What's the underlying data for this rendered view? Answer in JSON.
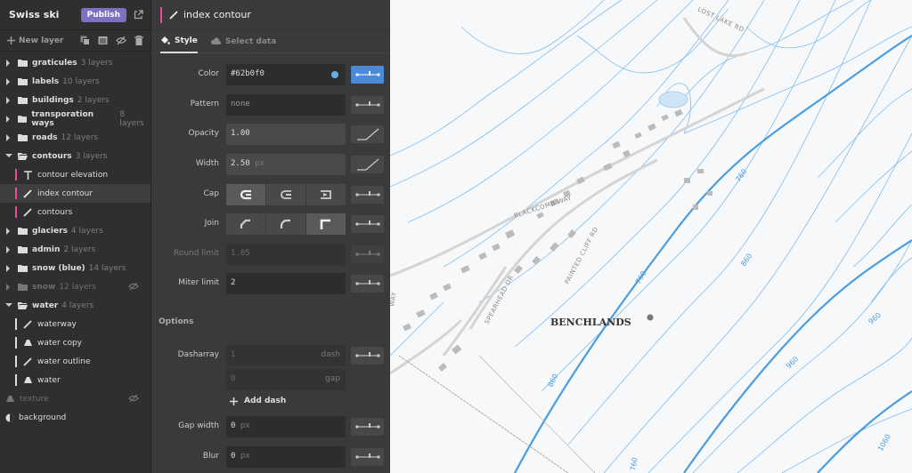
{
  "app": {
    "project_title": "Swiss ski",
    "publish_label": "Publish"
  },
  "toolbar": {
    "new_layer_label": "New layer"
  },
  "layers": {
    "graticules": {
      "name": "graticules",
      "count": "3 layers"
    },
    "labels": {
      "name": "labels",
      "count": "10 layers"
    },
    "buildings": {
      "name": "buildings",
      "count": "2 layers"
    },
    "transport": {
      "name": "transporation ways",
      "count": "8 layers"
    },
    "roads": {
      "name": "roads",
      "count": "12 layers"
    },
    "contours": {
      "name": "contours",
      "count": "3 layers"
    },
    "contour_elevation": {
      "name": "contour elevation"
    },
    "index_contour": {
      "name": "index contour"
    },
    "contours_child": {
      "name": "contours"
    },
    "glaciers": {
      "name": "glaciers",
      "count": "4 layers"
    },
    "admin": {
      "name": "admin",
      "count": "2 layers"
    },
    "snow_blue": {
      "name": "snow (blue)",
      "count": "14 layers"
    },
    "snow": {
      "name": "snow",
      "count": "12 layers"
    },
    "water": {
      "name": "water",
      "count": "4 layers"
    },
    "waterway": {
      "name": "waterway"
    },
    "water_copy": {
      "name": "water copy"
    },
    "water_outline": {
      "name": "water outline"
    },
    "water_child": {
      "name": "water"
    },
    "texture": {
      "name": "texture"
    },
    "background": {
      "name": "background"
    }
  },
  "panel": {
    "title": "index contour",
    "tabs": {
      "style": "Style",
      "select_data": "Select data"
    },
    "labels": {
      "color": "Color",
      "pattern": "Pattern",
      "opacity": "Opacity",
      "width": "Width",
      "cap": "Cap",
      "join": "Join",
      "round_limit": "Round limit",
      "miter_limit": "Miter limit",
      "options": "Options",
      "dasharray": "Dasharray",
      "gap_width": "Gap width",
      "blur": "Blur"
    },
    "values": {
      "color": "#62b0f0",
      "pattern": "none",
      "opacity": "1.00",
      "width": "2.50",
      "width_unit": "px",
      "round_limit": "1.05",
      "miter_limit": "2",
      "dash": "1",
      "dash_suffix": "dash",
      "gap": "0",
      "gap_suffix": "gap",
      "gap_width": "0",
      "gap_width_unit": "px",
      "blur": "0",
      "blur_unit": "px"
    },
    "add_dash_label": "Add dash"
  },
  "map": {
    "roads": [
      "LOST LAKE RD",
      "BLACKCOMB WAY",
      "PAINTED CLIFF RD",
      "SPEARHEAD DR",
      "WAY"
    ],
    "place": "BENCHLANDS",
    "elevations": [
      "760",
      "860",
      "960",
      "760",
      "760",
      "960",
      "1060",
      "860"
    ]
  },
  "colors": {
    "accent_pink": "#e54f9d",
    "contour_blue": "#62b0f0",
    "publish_purple": "#7e6fc0",
    "active_blue": "#4a8ad6"
  }
}
